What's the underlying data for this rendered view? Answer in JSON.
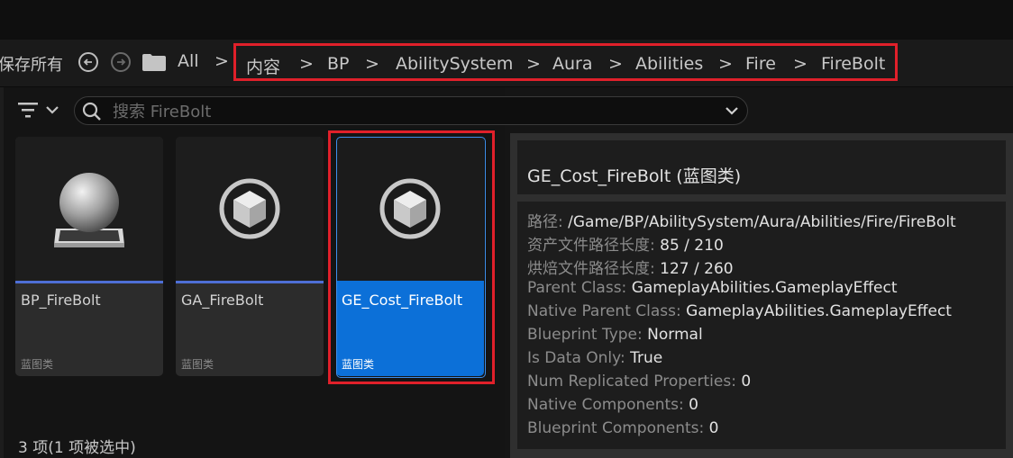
{
  "toolbar": {
    "save_all_label": "保存所有"
  },
  "navigation": {
    "root_label": "All",
    "separator": ">",
    "breadcrumbs": [
      "内容",
      "BP",
      "AbilitySystem",
      "Aura",
      "Abilities",
      "Fire",
      "FireBolt"
    ]
  },
  "search": {
    "placeholder": "搜索 FireBolt",
    "value": ""
  },
  "assets": [
    {
      "name": "BP_FireBolt",
      "type": "蓝图类",
      "icon": "sphere-mesh-icon",
      "selected": false
    },
    {
      "name": "GA_FireBolt",
      "type": "蓝图类",
      "icon": "cube-class-icon",
      "selected": false
    },
    {
      "name": "GE_Cost_FireBolt",
      "type": "蓝图类",
      "icon": "cube-class-icon",
      "selected": true
    }
  ],
  "status": {
    "text": "3 项(1 项被选中)"
  },
  "details": {
    "title": "GE_Cost_FireBolt (蓝图类)",
    "properties": [
      {
        "label": "路径:",
        "value": "/Game/BP/AbilitySystem/Aura/Abilities/Fire/FireBolt"
      },
      {
        "label": "资产文件路径长度:",
        "value": "85 / 210"
      },
      {
        "label": "烘焙文件路径长度:",
        "value": "127 / 260"
      },
      {
        "label": "Parent Class:",
        "value": "GameplayAbilities.GameplayEffect"
      },
      {
        "label": "Native Parent Class:",
        "value": "GameplayAbilities.GameplayEffect"
      },
      {
        "label": "Blueprint Type:",
        "value": "Normal"
      },
      {
        "label": "Is Data Only:",
        "value": "True"
      },
      {
        "label": "Num Replicated Properties:",
        "value": "0"
      },
      {
        "label": "Native Components:",
        "value": "0"
      },
      {
        "label": "Blueprint Components:",
        "value": "0"
      }
    ]
  },
  "colors": {
    "selection_blue": "#0c70d8",
    "blueprint_strip": "#4e6fd6",
    "highlight_red": "#e0202a"
  }
}
